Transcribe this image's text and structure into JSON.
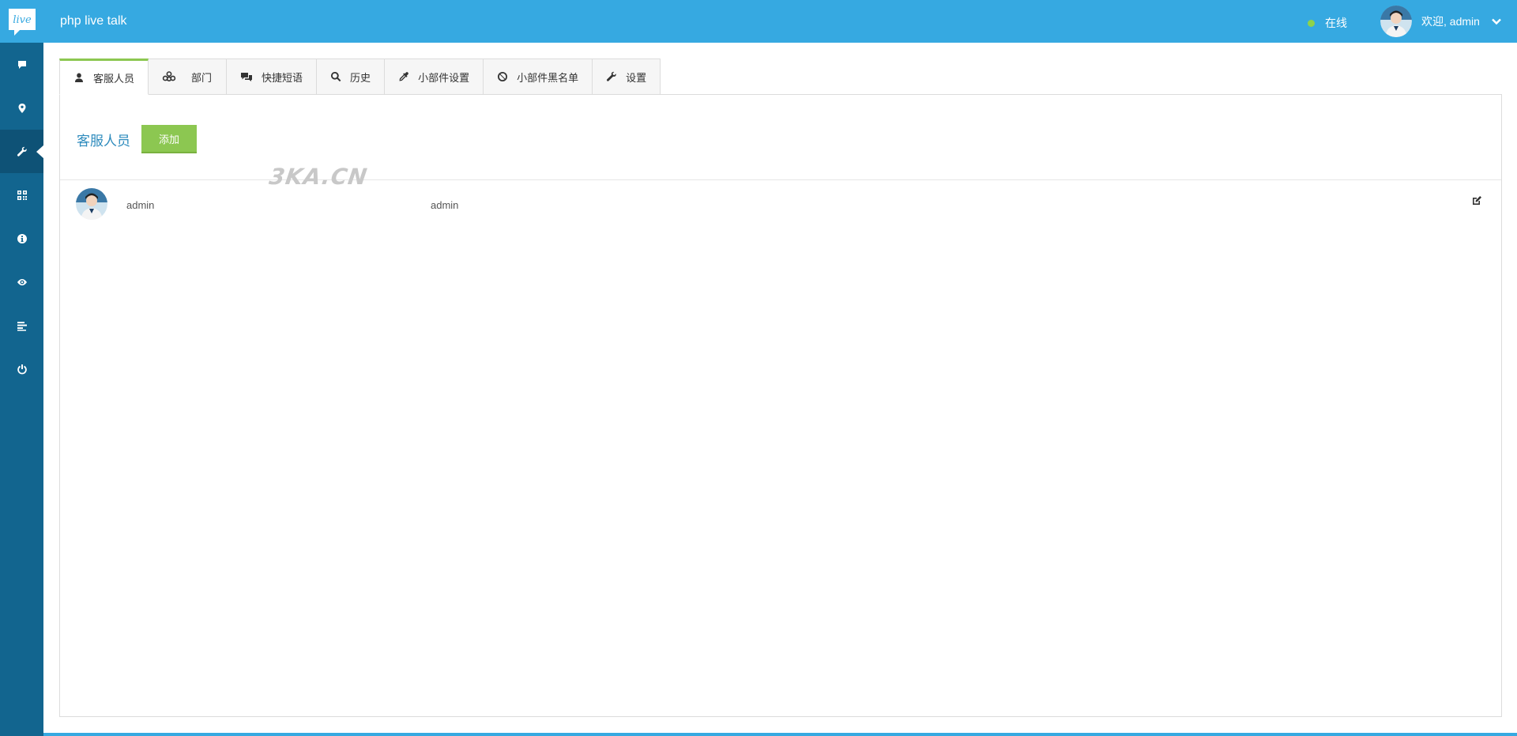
{
  "header": {
    "logo_text": "live",
    "app_title": "php live talk",
    "status_label": "在线",
    "welcome_text": "欢迎, admin",
    "status_color": "#8ed34b",
    "bar_color": "#36a9e1"
  },
  "sidebar": {
    "items": [
      {
        "icon": "chat-icon"
      },
      {
        "icon": "map-marker-icon"
      },
      {
        "icon": "wrench-icon",
        "active": true
      },
      {
        "icon": "qrcode-icon"
      },
      {
        "icon": "info-icon"
      },
      {
        "icon": "eye-icon"
      },
      {
        "icon": "align-left-icon"
      },
      {
        "icon": "power-icon"
      }
    ]
  },
  "tabs": [
    {
      "label": "客服人员",
      "icon": "user-icon",
      "active": true
    },
    {
      "label": "部门",
      "icon": "group-icon"
    },
    {
      "label": "快捷短语",
      "icon": "comments-icon"
    },
    {
      "label": "历史",
      "icon": "search-icon"
    },
    {
      "label": "小部件设置",
      "icon": "eyedropper-icon"
    },
    {
      "label": "小部件黑名单",
      "icon": "ban-icon"
    },
    {
      "label": "设置",
      "icon": "wrench-icon"
    }
  ],
  "panel": {
    "title": "客服人员",
    "add_label": "添加",
    "rows": [
      {
        "name": "admin",
        "username": "admin"
      }
    ]
  },
  "watermark": "3KA.CN"
}
